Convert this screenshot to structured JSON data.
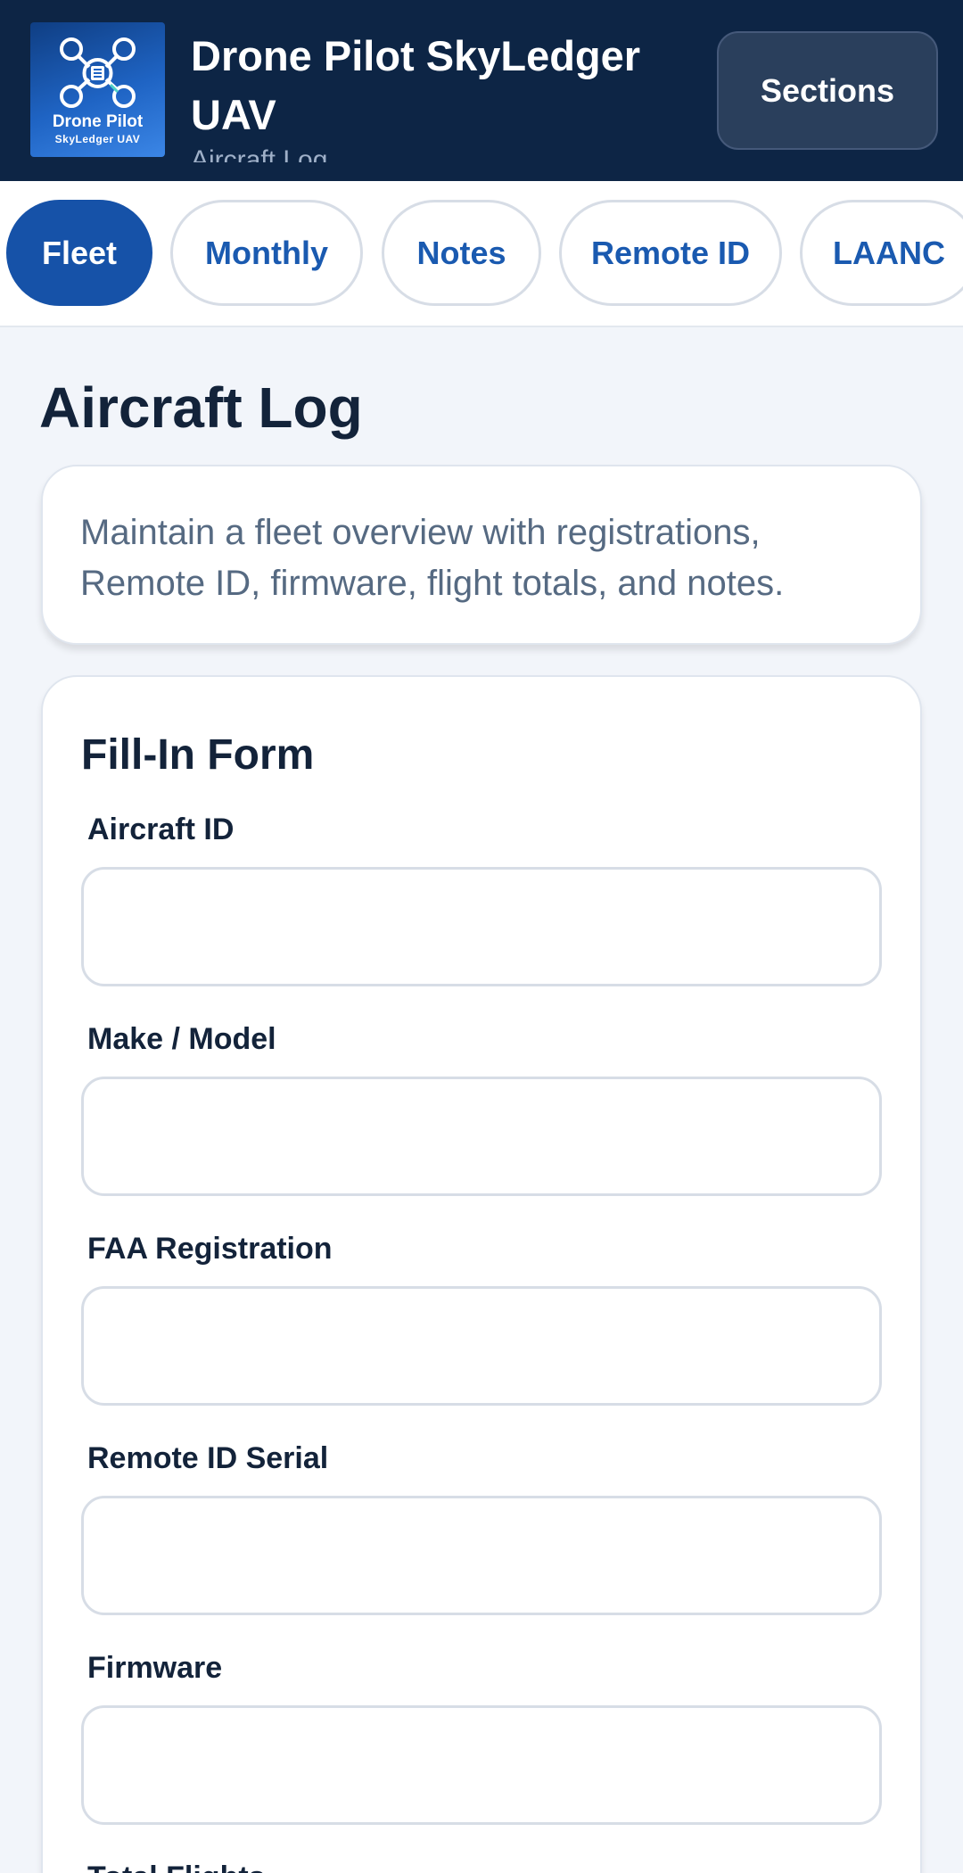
{
  "header": {
    "logo_line1": "Drone Pilot",
    "logo_line2": "SkyLedger UAV",
    "title": "Drone Pilot SkyLedger UAV",
    "subtitle": "Aircraft Log",
    "sections_label": "Sections"
  },
  "tabs": [
    {
      "label": "Fleet",
      "active": true
    },
    {
      "label": "Monthly",
      "active": false
    },
    {
      "label": "Notes",
      "active": false
    },
    {
      "label": "Remote ID",
      "active": false
    },
    {
      "label": "LAANC",
      "active": false
    }
  ],
  "page": {
    "title": "Aircraft Log",
    "intro": "Maintain a fleet overview with registrations, Remote ID, firmware, flight totals, and notes."
  },
  "form": {
    "title": "Fill-In Form",
    "fields": [
      {
        "label": "Aircraft ID",
        "value": ""
      },
      {
        "label": "Make / Model",
        "value": ""
      },
      {
        "label": "FAA Registration",
        "value": ""
      },
      {
        "label": "Remote ID Serial",
        "value": ""
      },
      {
        "label": "Firmware",
        "value": ""
      },
      {
        "label": "Total Flights",
        "value": ""
      }
    ]
  },
  "colors": {
    "header_bg": "#0d2545",
    "accent": "#1652a8",
    "page_bg": "#f2f5fa"
  }
}
